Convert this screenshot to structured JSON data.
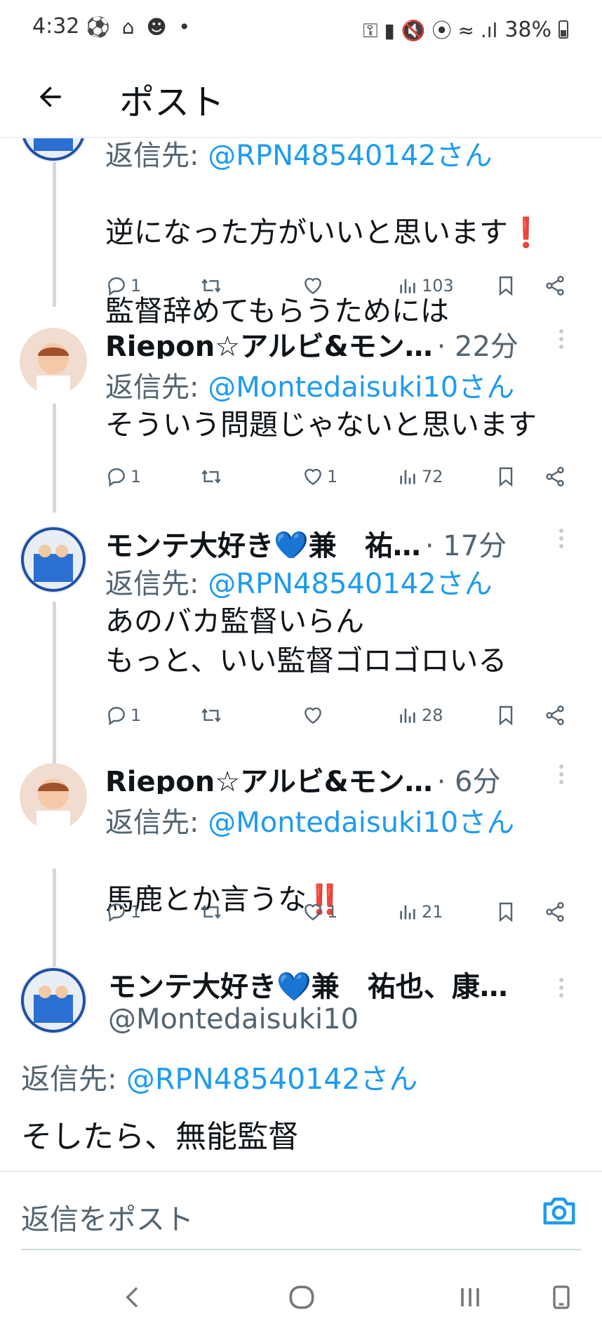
{
  "status_bar": {
    "time": "4:32",
    "left_icons": "⚽ ⌂ ☻ •",
    "right_icons": "⚿ ▮ 🔇 ⦿ ≈ .ıl",
    "battery": "38%"
  },
  "header": {
    "title": "ポスト"
  },
  "posts": [
    {
      "reply_prefix": "返信先: ",
      "reply_to": "@RPN48540142さん",
      "text_lines": [
        "逆になった方がいいと思います",
        "監督辞めてもらうためには"
      ],
      "emoji": "❗",
      "replies": "1",
      "reposts": "",
      "likes": "",
      "views": "103"
    },
    {
      "name": "Riepon☆アルビ&モン…",
      "time": "· 22分",
      "reply_prefix": "返信先: ",
      "reply_to": "@Montedaisuki10さん",
      "text": "そういう問題じゃないと思います",
      "replies": "1",
      "reposts": "",
      "likes": "1",
      "views": "72"
    },
    {
      "name": "モンテ大好き💙兼　祐…",
      "time": "· 17分",
      "reply_prefix": "返信先: ",
      "reply_to": "@RPN48540142さん",
      "text": "あのバカ監督いらん\nもっと、いい監督ゴロゴロいる",
      "replies": "1",
      "reposts": "",
      "likes": "",
      "views": "28"
    },
    {
      "name": "Riepon☆アルビ&モン…",
      "time": "· 6分",
      "reply_prefix": "返信先: ",
      "reply_to": "@Montedaisuki10さん",
      "text": "馬鹿とか言うな",
      "emoji": "‼️",
      "replies": "1",
      "reposts": "",
      "likes": "1",
      "views": "21"
    }
  ],
  "main_post": {
    "name": "モンテ大好き💙兼　祐也、康…",
    "handle": "@Montedaisuki10",
    "reply_prefix": "返信先: ",
    "reply_to": "@RPN48540142さん",
    "text": "そしたら、無能監督"
  },
  "composer": {
    "placeholder": "返信をポスト"
  },
  "colors": {
    "accent": "#1d9bf0",
    "secondary_text": "#536471",
    "thread_line": "#cfd9de"
  }
}
